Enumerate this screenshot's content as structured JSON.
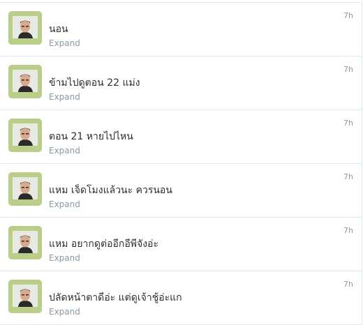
{
  "tweets": [
    {
      "time": "7h",
      "text": "นอน",
      "expand_label": "Expand",
      "avatar_icon": "user-avatar"
    },
    {
      "time": "7h",
      "text": "ข้ามไปดูตอน 22 แม่ง",
      "expand_label": "Expand",
      "avatar_icon": "user-avatar"
    },
    {
      "time": "7h",
      "text": "ตอน 21 หายไปไหน",
      "expand_label": "Expand",
      "avatar_icon": "user-avatar"
    },
    {
      "time": "7h",
      "text": "แหม เจ็ดโมงแล้วนะ ควรนอน",
      "expand_label": "Expand",
      "avatar_icon": "user-avatar"
    },
    {
      "time": "7h",
      "text": "แหม อยากดูต่ออีกอีพีจังอ่ะ",
      "expand_label": "Expand",
      "avatar_icon": "user-avatar"
    },
    {
      "time": "7h",
      "text": "ปลัดหน้าตาดีอ่ะ แต่ดูเจ้าชู้อ่ะแก",
      "expand_label": "Expand",
      "avatar_icon": "user-avatar"
    }
  ],
  "colors": {
    "avatar_bg": "#b9cf88",
    "muted_text": "#8899a6",
    "body_text": "#292f33",
    "divider": "#e1e8ed"
  }
}
